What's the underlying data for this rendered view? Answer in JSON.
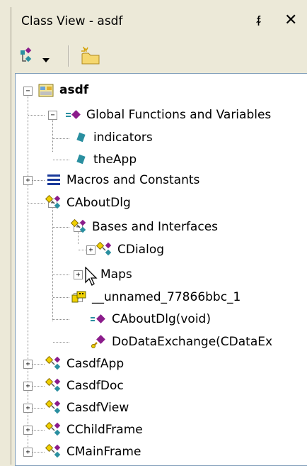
{
  "window": {
    "title": "Class View - asdf",
    "pin_glyph": "ᵮ",
    "close_glyph": "✕"
  },
  "toolbar": {
    "sort_icon": "sort-members-icon",
    "dropdown_icon": "chevron-down-icon",
    "new_folder_icon": "new-folder-icon"
  },
  "tree": {
    "root": {
      "label": "asdf",
      "icon": "project-icon"
    },
    "nodes": [
      {
        "label": "Global Functions and Variables",
        "icon": "global-functions-icon"
      },
      {
        "label": "indicators",
        "icon": "variable-icon"
      },
      {
        "label": "theApp",
        "icon": "variable-icon"
      },
      {
        "label": "Macros and Constants",
        "icon": "macros-icon"
      },
      {
        "label": "CAboutDlg",
        "icon": "class-icon"
      },
      {
        "label": "Bases and Interfaces",
        "icon": "class-icon"
      },
      {
        "label": "CDialog",
        "icon": "class-icon"
      },
      {
        "label": "Maps",
        "icon": "maps-icon"
      },
      {
        "label": "__unnamed_77866bbc_1",
        "icon": "struct-icon"
      },
      {
        "label": "CAboutDlg(void)",
        "icon": "method-icon"
      },
      {
        "label": "DoDataExchange(CDataEx",
        "icon": "protected-method-icon"
      },
      {
        "label": "CasdfApp",
        "icon": "class-icon"
      },
      {
        "label": "CasdfDoc",
        "icon": "class-icon"
      },
      {
        "label": "CasdfView",
        "icon": "class-icon"
      },
      {
        "label": "CChildFrame",
        "icon": "class-icon"
      },
      {
        "label": "CMainFrame",
        "icon": "class-icon"
      }
    ]
  },
  "colors": {
    "panel_bg": "#ece9d8",
    "tree_bg": "#ffffff",
    "method_purple": "#8b1c8b",
    "variable_teal": "#2a8fa0",
    "class_yellow": "#f0d000"
  }
}
